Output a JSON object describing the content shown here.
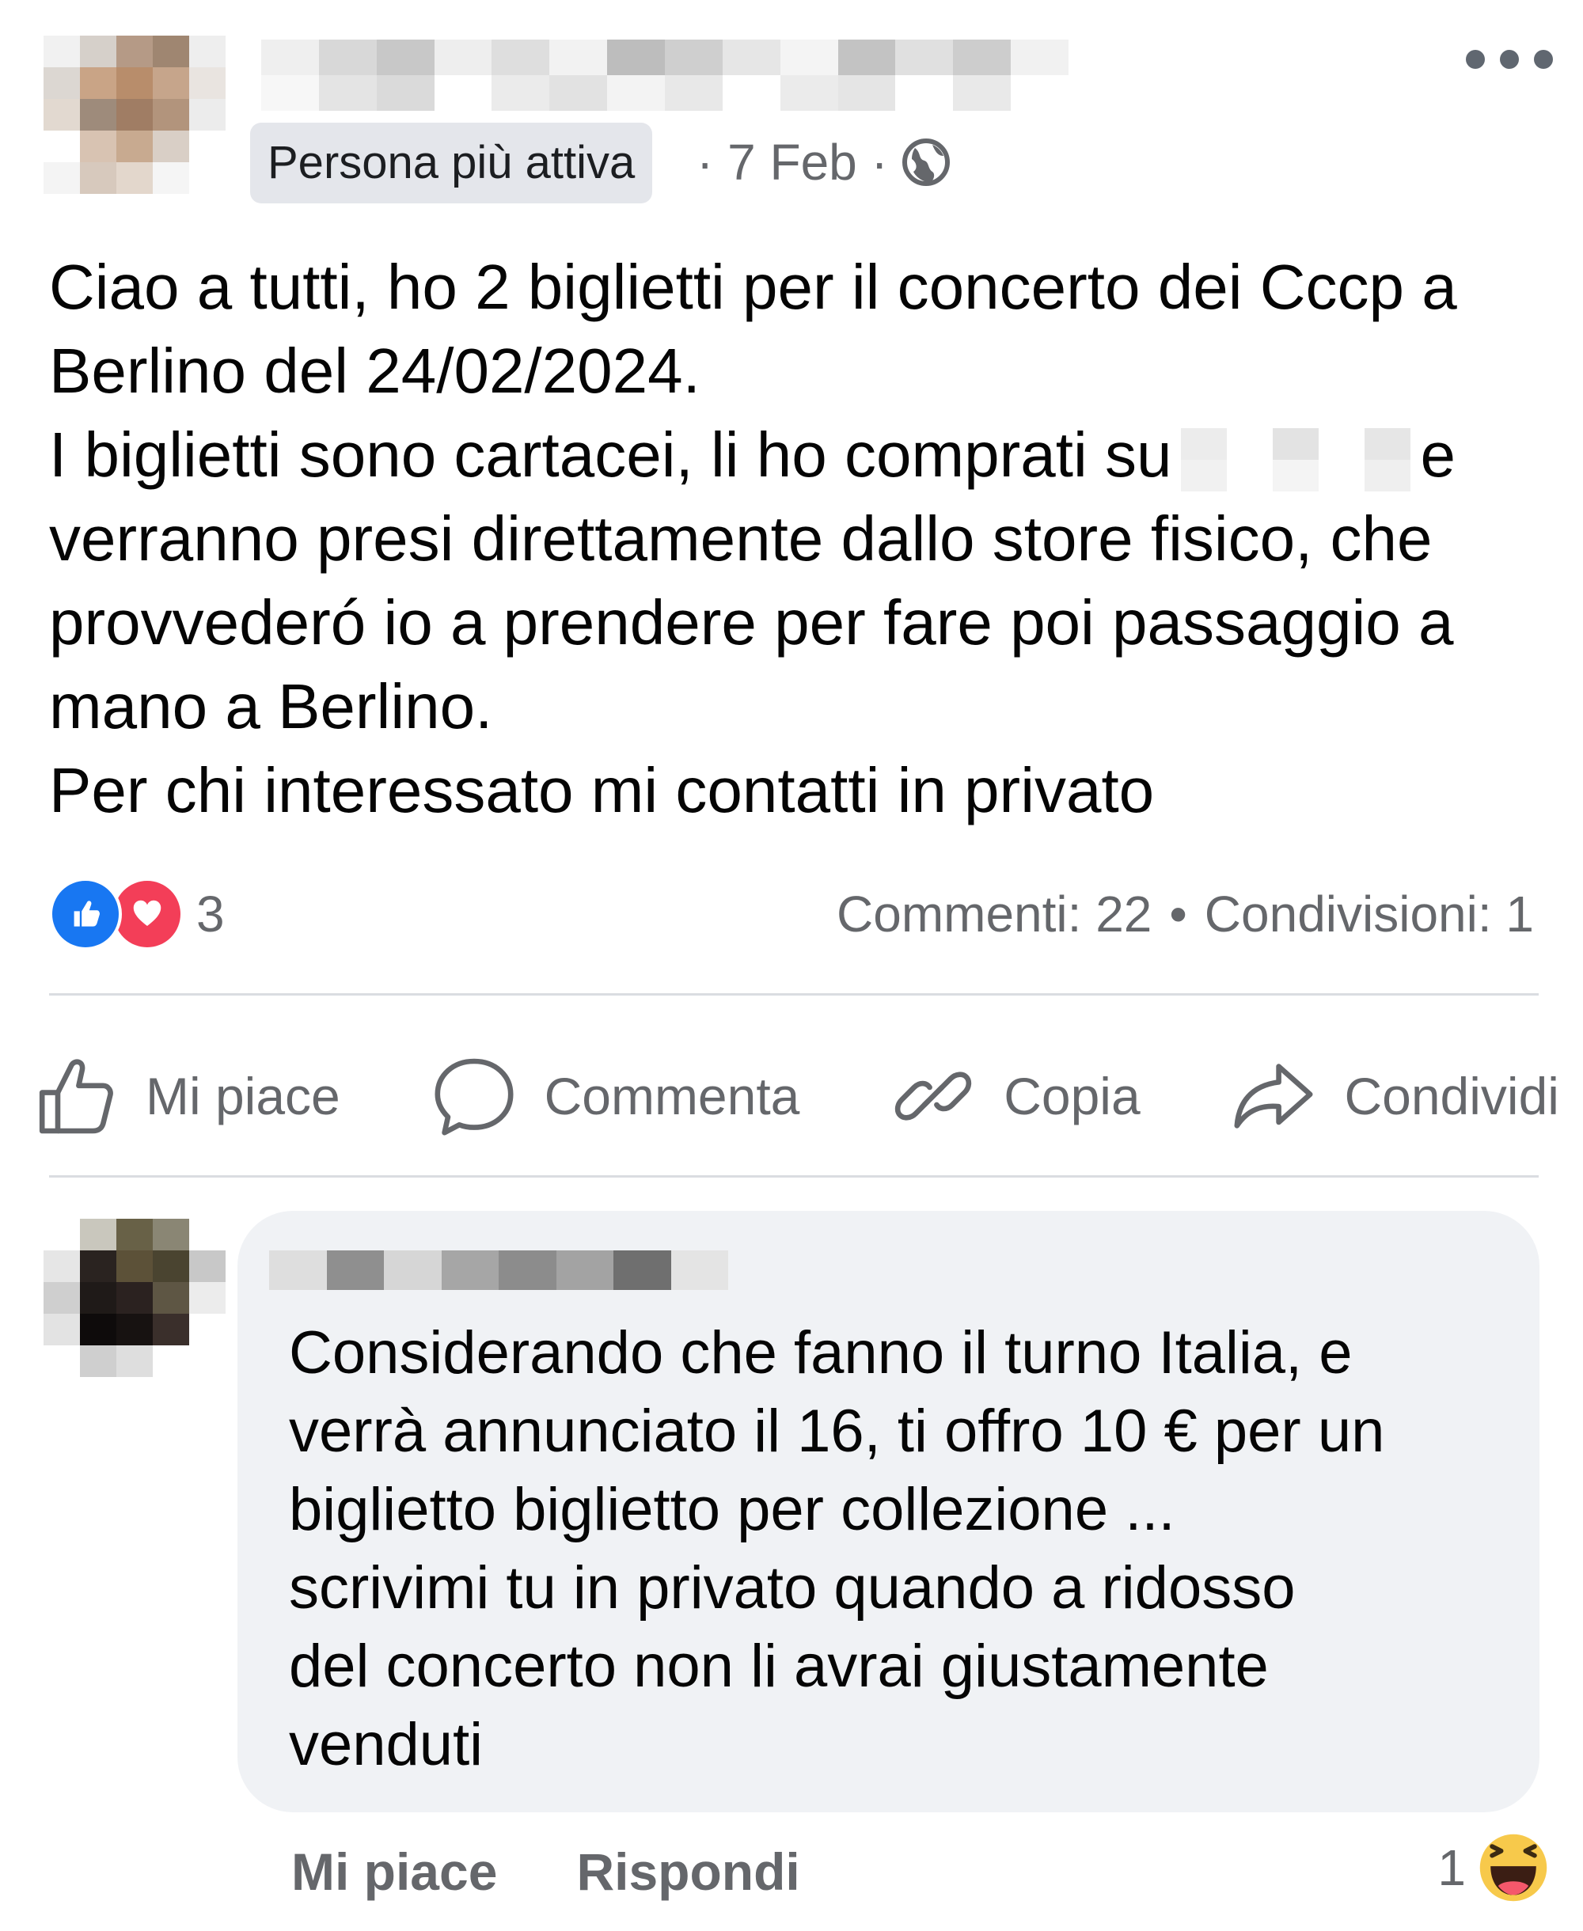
{
  "post": {
    "author_badge": "Persona più attiva",
    "date": "· 7 Feb ·",
    "paragraphs": [
      "Ciao a tutti, ho 2 biglietti per il concerto dei Cccp a Berlino del 24/02/2024.",
      "I biglietti sono cartacei, li ho comprati su",
      "e",
      "verranno presi direttamente dallo store fisico, che provvederó io a prendere per fare poi passaggio a mano a Berlino.",
      "Per chi interessato mi contatti in privato"
    ],
    "reaction_count": "3",
    "comments": "Commenti: 22",
    "stats_separator": "•",
    "shares": "Condivisioni: 1"
  },
  "actions": {
    "like": "Mi piace",
    "comment": "Commenta",
    "copy": "Copia",
    "share": "Condividi"
  },
  "comment": {
    "lines": [
      "Considerando che fanno il turno Italia, e",
      "verrà annunciato il 16, ti offro 10 € per un",
      "biglietto biglietto per collezione ...",
      "scrivimi tu in privato quando a ridosso",
      "del concerto non li avrai giustamente",
      "venduti"
    ],
    "like_label": "Mi piace",
    "reply_label": "Rispondi",
    "reaction_count": "1"
  },
  "colors": {
    "text": "#050505",
    "secondary": "#65676b",
    "like_blue": "#1877f2",
    "love_red": "#f33e58",
    "bubble_bg": "#f0f2f5"
  },
  "icons": [
    "more-options-icon",
    "globe-icon",
    "like-reaction-icon",
    "love-reaction-icon",
    "thumbs-up-icon",
    "comment-icon",
    "link-icon",
    "share-arrow-icon",
    "haha-reaction-icon"
  ]
}
